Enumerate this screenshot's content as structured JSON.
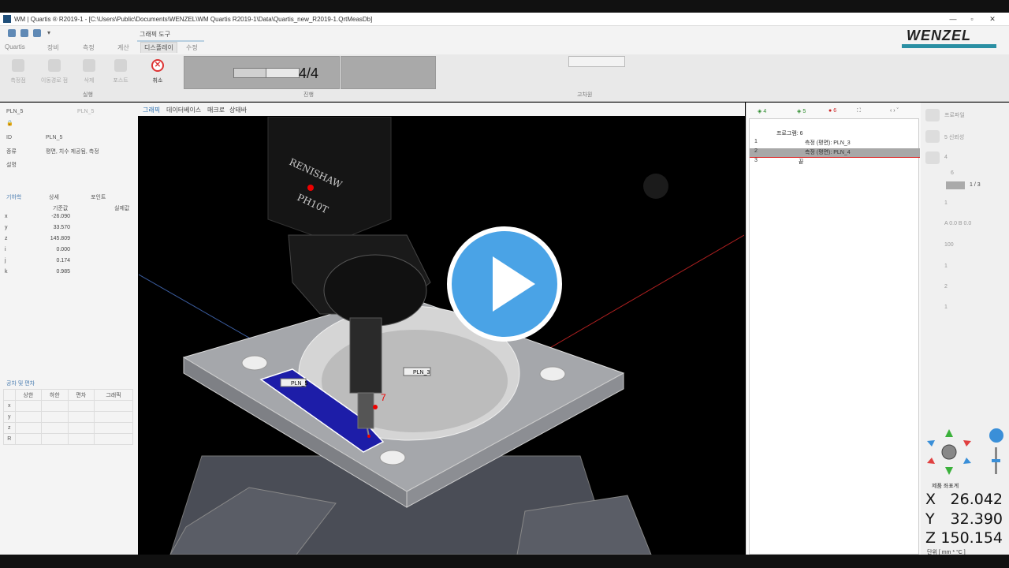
{
  "window": {
    "title": "WM | Quartis ® R2019-1 - [C:\\Users\\Public\\Documents\\WENZEL\\WM Quartis R2019-1\\Data\\Quartis_new_R2019-1.QrtMeasDb]"
  },
  "ribbon": {
    "context_group_title": "그래픽 도구",
    "tabs": [
      "Quartis",
      "장비",
      "측정",
      "계산",
      "디스플레이",
      "수정"
    ],
    "active_tab": "디스플레이",
    "logo": "WENZEL",
    "buttons": [
      "측정점",
      "이동경로 점",
      "삭제",
      "포스트",
      "취소"
    ],
    "groups": [
      "실행",
      "진행",
      "고차원"
    ],
    "progress": {
      "text": "4/4",
      "fraction": 0.5
    }
  },
  "left_panel": {
    "feature_tabs": [
      "PLN_5",
      "PLN_5"
    ],
    "props": [
      {
        "key": "ID",
        "value": "PLN_5"
      },
      {
        "key": "종류",
        "value": "평면, 치수 제공됨, 측정"
      },
      {
        "key": "설명",
        "value": ""
      }
    ],
    "section_tabs": [
      "기하학",
      "상세",
      "포인트"
    ],
    "grid_headers": [
      "기준값",
      "실제값"
    ],
    "grid_rows": [
      {
        "k": "x",
        "v": "-26.090"
      },
      {
        "k": "y",
        "v": "33.570"
      },
      {
        "k": "z",
        "v": "145.809"
      },
      {
        "k": "i",
        "v": "0.000"
      },
      {
        "k": "j",
        "v": "0.174"
      },
      {
        "k": "k",
        "v": "0.985"
      }
    ],
    "tolerance_title": "공차 및 편차",
    "tolerance_headers": [
      "",
      "상한",
      "하한",
      "편차",
      "그래픽"
    ],
    "tolerance_rows": [
      "x",
      "y",
      "z",
      "R"
    ]
  },
  "viewport": {
    "tabs": [
      "그래픽",
      "데이터베이스",
      "매크로",
      "상태바"
    ],
    "labels": {
      "pln3": "PLN_3",
      "pln5": "PLN_5"
    },
    "probe_brand": "RENISHAW",
    "probe_model": "PH10T",
    "point_number": "7"
  },
  "right_panel": {
    "toolbar": [
      "4",
      "5",
      "6"
    ],
    "program_title": "프로그램: 6",
    "rows": [
      {
        "n": "1",
        "t": "측정 (평면): PLN_3"
      },
      {
        "n": "2",
        "t": "측정 (평면): PLN_4"
      },
      {
        "n": "3",
        "t": "끝"
      }
    ],
    "selected_row": 1
  },
  "far_right": {
    "items": [
      "프로파일",
      "5 신뢰성",
      "4",
      "6",
      "1 / 3",
      "1",
      "A 0.0 B 0.0",
      "100",
      "1",
      "2",
      "1"
    ],
    "coord_system_label": "제품 좌표계",
    "coords": [
      {
        "label": "X",
        "value": "26.042"
      },
      {
        "label": "Y",
        "value": "32.390"
      },
      {
        "label": "Z",
        "value": "150.154"
      }
    ],
    "units": "단위 [ mm * °C ]"
  },
  "colors": {
    "accent": "#2a8fa3",
    "play": "#4aa3e6",
    "selection": "#c8c8c8",
    "plane_fill": "#1d1da8"
  }
}
